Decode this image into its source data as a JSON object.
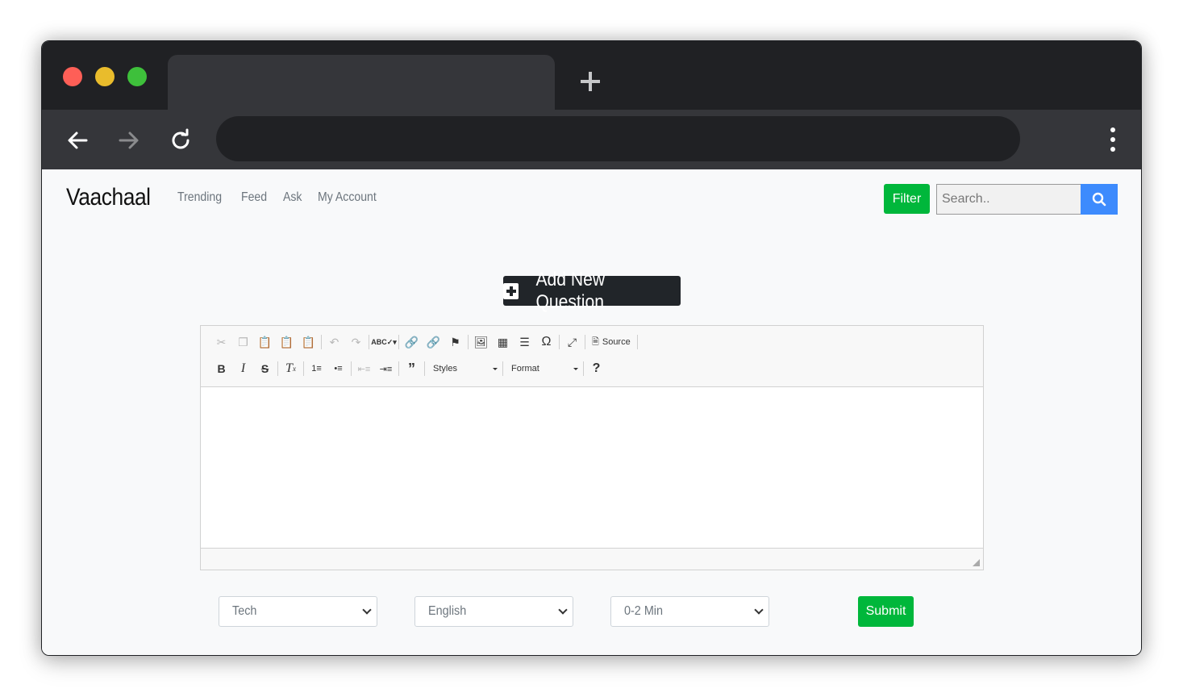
{
  "browser": {
    "new_tab_icon": "plus-icon",
    "back_icon": "arrow-left-icon",
    "forward_icon": "arrow-right-icon",
    "reload_icon": "reload-icon",
    "menu_icon": "kebab-menu-icon"
  },
  "header": {
    "brand": "Vaachaal",
    "nav": [
      "Trending",
      "Feed",
      "Ask",
      "My Account"
    ],
    "filter_label": "Filter",
    "search_placeholder": "Search.."
  },
  "main": {
    "add_question_label": "Add New Question",
    "editor": {
      "source_label": "Source",
      "styles_label": "Styles",
      "format_label": "Format",
      "help_label": "?"
    },
    "category_select": "Tech",
    "language_select": "English",
    "duration_select": "0-2 Min",
    "submit_label": "Submit"
  },
  "colors": {
    "accent_green": "#00b73b",
    "search_blue": "#3d8bfd",
    "dark": "#212529"
  }
}
